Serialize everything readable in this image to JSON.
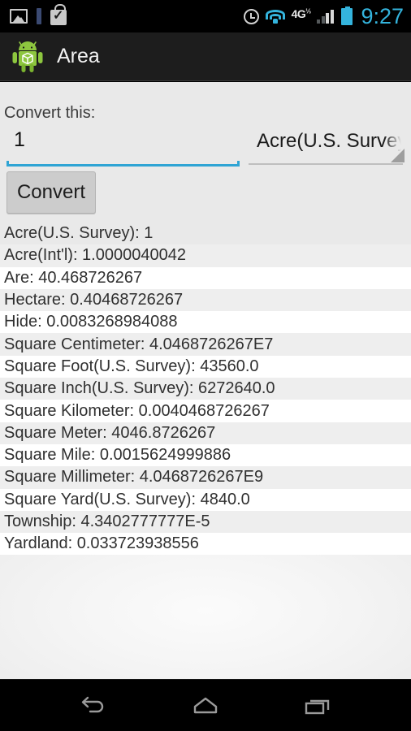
{
  "statusbar": {
    "clock": "9:27",
    "network_label": "4G",
    "network_sup": "⅓",
    "icons": [
      "screenshot-icon",
      "blue-bar-icon",
      "play-store-bag-icon",
      "alarm-icon",
      "wifi-icon",
      "4g-icon",
      "signal-icon",
      "battery-icon"
    ]
  },
  "actionbar": {
    "title": "Area",
    "icon": "android-cube-app-icon"
  },
  "form": {
    "label": "Convert this:",
    "input_value": "1",
    "input_placeholder": "",
    "unit_selected": "Acre(U.S. Survey)",
    "convert_label": "Convert"
  },
  "results": [
    {
      "label": "Acre(U.S. Survey)",
      "value": "1",
      "text": "Acre(U.S. Survey): 1"
    },
    {
      "label": "Acre(Int'l)",
      "value": "1.0000040042",
      "text": "Acre(Int'l): 1.0000040042"
    },
    {
      "label": "Are",
      "value": "40.468726267",
      "text": "Are: 40.468726267"
    },
    {
      "label": "Hectare",
      "value": "0.40468726267",
      "text": "Hectare: 0.40468726267"
    },
    {
      "label": "Hide",
      "value": "0.0083268984088",
      "text": "Hide: 0.0083268984088"
    },
    {
      "label": "Square Centimeter",
      "value": "4.0468726267E7",
      "text": "Square Centimeter: 4.0468726267E7"
    },
    {
      "label": "Square Foot(U.S. Survey)",
      "value": "43560.0",
      "text": "Square Foot(U.S. Survey): 43560.0"
    },
    {
      "label": "Square Inch(U.S. Survey)",
      "value": "6272640.0",
      "text": "Square Inch(U.S. Survey): 6272640.0"
    },
    {
      "label": "Square Kilometer",
      "value": "0.0040468726267",
      "text": "Square Kilometer: 0.0040468726267"
    },
    {
      "label": "Square Meter",
      "value": "4046.8726267",
      "text": "Square Meter: 4046.8726267"
    },
    {
      "label": "Square Mile",
      "value": "0.0015624999886",
      "text": "Square Mile: 0.0015624999886"
    },
    {
      "label": "Square Millimeter",
      "value": "4.0468726267E9",
      "text": "Square Millimeter: 4.0468726267E9"
    },
    {
      "label": "Square Yard(U.S. Survey)",
      "value": "4840.0",
      "text": "Square Yard(U.S. Survey): 4840.0"
    },
    {
      "label": "Township",
      "value": "4.3402777777E-5",
      "text": "Township: 4.3402777777E-5"
    },
    {
      "label": "Yardland",
      "value": "0.033723938556",
      "text": "Yardland: 0.033723938556"
    }
  ],
  "navbar": {
    "back": "back-icon",
    "home": "home-icon",
    "recents": "recents-icon"
  },
  "colors": {
    "accent": "#33b5e5",
    "actionbar_bg": "#1d1d1d",
    "content_bg": "#e9e9e9",
    "row_alt": "#eeeeee"
  }
}
